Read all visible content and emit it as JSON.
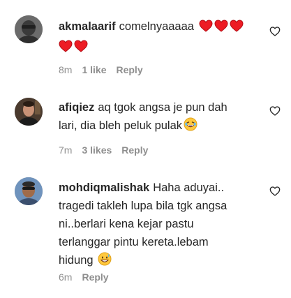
{
  "comments": [
    {
      "username": "akmalaarif",
      "text": "comelnyaaaaa",
      "emoji": "red-heart x5",
      "time": "8m",
      "likes": "1 like",
      "reply": "Reply"
    },
    {
      "username": "afiqiez",
      "text_line1": "aq tgok angsa je pun dah",
      "text_line2": "lari, dia bleh peluk pulak",
      "emoji": "laughing-face",
      "time": "7m",
      "likes": "3 likes",
      "reply": "Reply"
    },
    {
      "username": "mohdiqmalishak",
      "text_line1": "Haha aduyai..",
      "text_line2": "tragedi takleh lupa bila tgk angsa",
      "text_line3": "ni..berlari kena kejar pastu",
      "text_line4": "terlanggar pintu kereta.lebam",
      "text_line5": "hidung",
      "emoji": "grinning-sweat-face",
      "time": "6m",
      "reply": "Reply"
    }
  ],
  "colors": {
    "text": "#262626",
    "meta": "#8e8e8e",
    "heart_red": "#ed1c24"
  }
}
